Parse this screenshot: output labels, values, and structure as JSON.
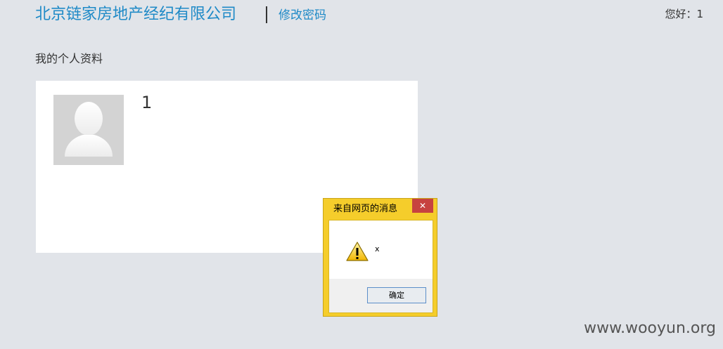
{
  "header": {
    "title": "北京链家房地产经纪有限公司",
    "change_password": "修改密码",
    "greeting": "您好：1"
  },
  "profile": {
    "section_title": "我的个人资料",
    "avatar_icon": "default-user-avatar-icon",
    "name": "1"
  },
  "dialog": {
    "title": "来自网页的消息",
    "close_glyph": "✕",
    "icon": "warning-icon",
    "message": "x",
    "ok_label": "确定"
  },
  "watermark": "www.wooyun.org",
  "colors": {
    "page_bg": "#e1e4e9",
    "brand_blue": "#1f8ac7",
    "dialog_frame": "#f5cd2b",
    "close_red": "#c7423f"
  }
}
